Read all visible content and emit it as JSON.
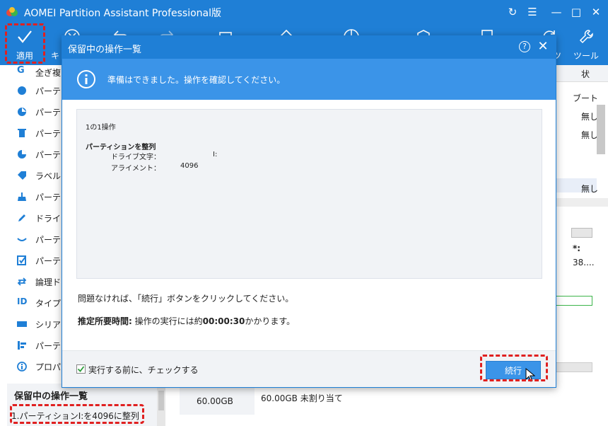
{
  "app": {
    "title": "AOMEI Partition Assistant Professional版"
  },
  "toolbar": {
    "apply_label": "適用",
    "items": [
      {
        "label": "キ",
        "icon": "cancel-icon"
      },
      {
        "label": "",
        "icon": "undo-icon"
      },
      {
        "label": "",
        "icon": "redo-icon"
      },
      {
        "label": "",
        "icon": "clone-icon"
      },
      {
        "label": "",
        "icon": "wipe-icon"
      },
      {
        "label": "",
        "icon": "allocate-icon"
      },
      {
        "label": "",
        "icon": "migrate-icon"
      },
      {
        "label": "",
        "icon": "bootable-icon"
      },
      {
        "label": "ツ",
        "icon": "tools-refresh-icon"
      },
      {
        "label": "ツール",
        "icon": "wrench-icon"
      }
    ]
  },
  "sidebar": {
    "items": [
      {
        "label": "全ぎ複",
        "icon": "clone-icon"
      },
      {
        "label": "パーテ",
        "icon": "resize-icon"
      },
      {
        "label": "パーテ",
        "icon": "move-icon"
      },
      {
        "label": "パーテ",
        "icon": "delete-icon"
      },
      {
        "label": "パーテ",
        "icon": "format-icon"
      },
      {
        "label": "ラベル",
        "icon": "label-icon"
      },
      {
        "label": "パーテ",
        "icon": "wipe-icon"
      },
      {
        "label": "ドライ",
        "icon": "drive-letter-icon"
      },
      {
        "label": "パーテ",
        "icon": "hide-icon"
      },
      {
        "label": "パーテ",
        "icon": "check-icon"
      },
      {
        "label": "論理ド",
        "icon": "convert-icon"
      },
      {
        "label": "タイプ",
        "icon": "id-icon"
      },
      {
        "label": "シリア",
        "icon": "serial-icon"
      },
      {
        "label": "パーテ",
        "icon": "align-icon"
      },
      {
        "label": "プロパ",
        "icon": "info-icon"
      }
    ]
  },
  "pending": {
    "title": "保留中の操作一覧",
    "item": "1.パーティションI:を4096に整列"
  },
  "right_panel": {
    "header": "状",
    "rows": [
      "ブート",
      "無し",
      "無し",
      "無し"
    ],
    "disk_label": "*:",
    "disk_size": "38...."
  },
  "bottom": {
    "disk_size": "60.00GB",
    "unallocated": "60.00GB 未割り当て"
  },
  "dialog": {
    "title": "保留中の操作一覧",
    "banner": "準備はできました。操作を確認してください。",
    "ops_count": "1の1操作",
    "op_name": "パーティションを整列",
    "rows": [
      {
        "label": "ドライブ文字：",
        "value": "I:"
      },
      {
        "label": "アライメント：",
        "value": "4096"
      }
    ],
    "message": "問題なければ、「続行」ボタンをクリックしてください。",
    "time_label": "推定所要時間:",
    "time_text_before": "操作の実行には約",
    "time_value": "00:00:30",
    "time_text_after": "かかります。",
    "checkbox_label": "実行する前に、チェックする",
    "checkbox_checked": true,
    "continue_label": "続行"
  },
  "colors": {
    "brand_blue": "#1f7fd6",
    "banner_blue": "#3b94e8",
    "highlight_red": "#e02020"
  }
}
